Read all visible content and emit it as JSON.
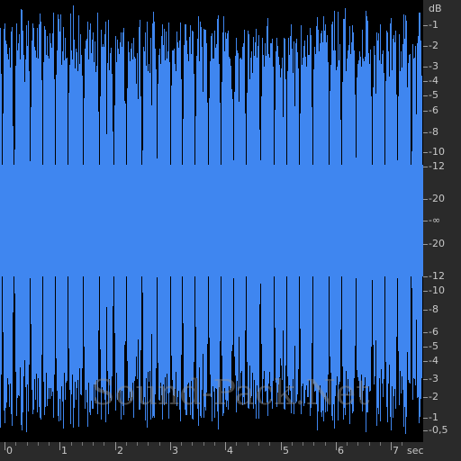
{
  "db_scale": {
    "unit": "dB",
    "labels": [
      "-1",
      "-2",
      "-3",
      "-4",
      "-5",
      "-6",
      "-8",
      "-10",
      "-12",
      "-20",
      "-∞",
      "-20",
      "-12",
      "-10",
      "-8",
      "-6",
      "-5",
      "-4",
      "-3",
      "-2",
      "-1",
      "-0,5"
    ]
  },
  "time_axis": {
    "unit": "sec",
    "labels": [
      "0",
      "1",
      "2",
      "3",
      "4",
      "5",
      "6",
      "7"
    ]
  },
  "watermark": "Sound-Pack.Net",
  "colors": {
    "waveform": "#3f86f0",
    "background": "#000000",
    "ruler": "#2a2a2a",
    "ruler_text": "#c8c8c8"
  },
  "icons": []
}
